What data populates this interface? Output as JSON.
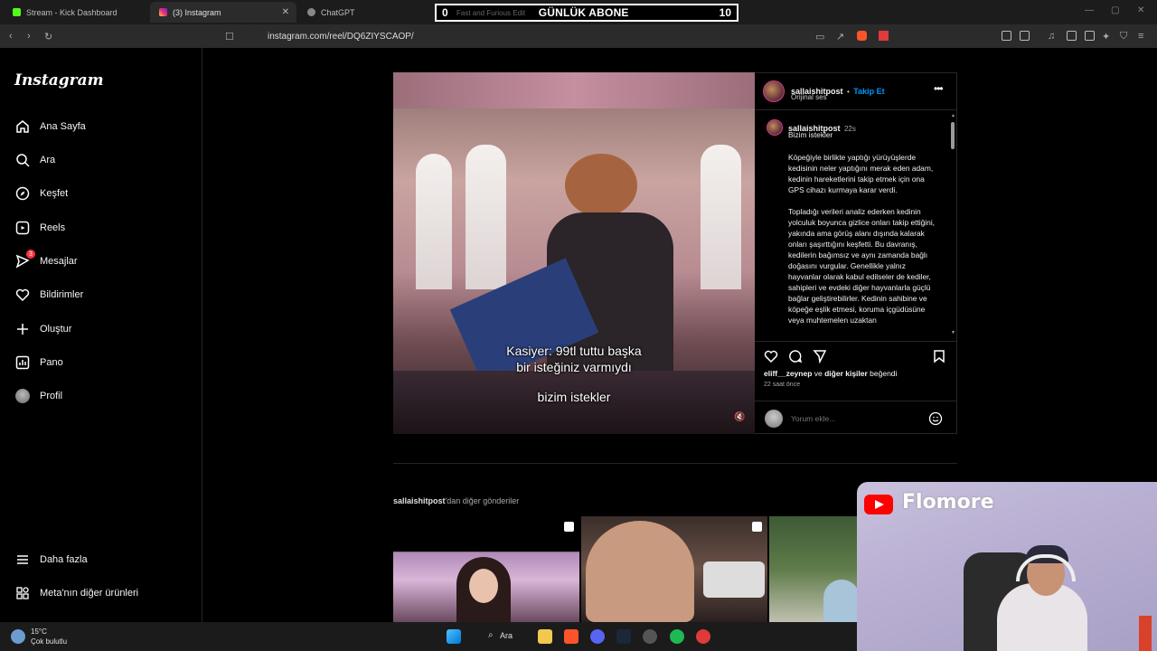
{
  "browser": {
    "tabs": [
      {
        "label": "Stream - Kick Dashboard",
        "color": "#53fc18"
      },
      {
        "label": "(3) Instagram",
        "color": "#e1306c"
      },
      {
        "label": "ChatGPT",
        "color": "#aaaaaa"
      }
    ],
    "url": "instagram.com/reel/DQ6ZIYSCAOP/"
  },
  "overlay": {
    "left_count": "0",
    "title": "GÜNLÜK ABONE",
    "right_count": "10",
    "faint": "Fast and Furious Edit"
  },
  "sidebar": {
    "logo": "Instagram",
    "items": [
      {
        "label": "Ana Sayfa",
        "icon": "home-icon"
      },
      {
        "label": "Ara",
        "icon": "search-icon"
      },
      {
        "label": "Keşfet",
        "icon": "compass-icon"
      },
      {
        "label": "Reels",
        "icon": "reels-icon"
      },
      {
        "label": "Mesajlar",
        "icon": "messenger-icon",
        "badge": "3"
      },
      {
        "label": "Bildirimler",
        "icon": "heart-icon"
      },
      {
        "label": "Oluştur",
        "icon": "plus-icon"
      },
      {
        "label": "Pano",
        "icon": "dashboard-icon"
      },
      {
        "label": "Profil",
        "icon": "profile-avatar"
      }
    ],
    "more": "Daha fazla",
    "meta": "Meta'nın diğer ürünleri"
  },
  "post": {
    "username": "sallaishitpost",
    "dot": "•",
    "follow": "Takip Et",
    "audio": "Orijinal ses",
    "comment_time": "22s",
    "caption_title": "Bizim istekler",
    "description": "Köpeğiyle birlikte yaptığı yürüyüşlerde kedisinin neler yaptığını merak eden adam, kedinin hareketlerini takip etmek için ona GPS cihazı kurmaya karar verdi.\n\nTopladığı verileri analiz ederken kedinin yolculuk boyunca gizlice onları takip ettiğini, yakında ama görüş alanı dışında kalarak onları şaşırttığını keşfetti. Bu davranış, kedilerin bağımsız ve aynı zamanda bağlı doğasını vurgular. Genellikle yalnız hayvanlar olarak kabul edilseler de kediler, sahipleri ve evdeki diğer hayvanlarla güçlü bağlar geliştirebilirler. Kedinin sahibine ve köpeğe eşlik etmesi, koruma içgüdüsüne veya muhtemelen uzaktan",
    "video_caption_1": "Kasiyer: 99tl tuttu başka",
    "video_caption_2": "bir isteğiniz varmıydı",
    "video_caption_3": "bizim istekler",
    "liked_user": "eliff__zeynep",
    "liked_mid": " ve ",
    "liked_others": "diğer kişiler",
    "liked_suffix": " beğendi",
    "posted_ago": "22 saat önce",
    "comment_placeholder": "Yorum ekle..."
  },
  "more_posts": {
    "user": "sallaishitpost",
    "suffix": "'dan diğer gönderiler"
  },
  "cam": {
    "brand": "Flomore"
  },
  "taskbar": {
    "temp": "15°C",
    "weather": "Çok bulutlu",
    "search": "Ara"
  }
}
